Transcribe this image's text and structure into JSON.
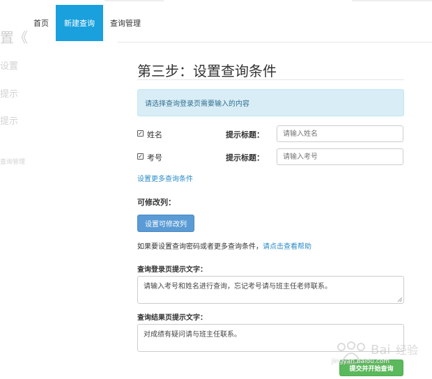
{
  "background_fragments": {
    "title": "置《",
    "line1": "设置",
    "line2": "提示",
    "line3": "提示",
    "line4": "查询管理"
  },
  "nav": {
    "items": [
      {
        "label": "首页",
        "active": false
      },
      {
        "label": "新建查询",
        "active": true
      },
      {
        "label": "查询管理",
        "active": false
      }
    ],
    "active_color": "#1aa0dc"
  },
  "step": {
    "title": "第三步：设置查询条件"
  },
  "info": {
    "text": "请选择查询登录页需要输入的内容"
  },
  "conditions": [
    {
      "name": "姓名",
      "checked": true,
      "prompt_label": "提示标题：",
      "placeholder": "请输入姓名"
    },
    {
      "name": "考号",
      "checked": true,
      "prompt_label": "提示标题：",
      "placeholder": "请输入考号"
    }
  ],
  "more_conditions_link": "设置更多查询条件",
  "editable": {
    "label": "可修改列：",
    "button": "设置可修改列"
  },
  "help": {
    "text": "如果要设置查询密码或者更多查询条件，",
    "link": "请点击查看帮助"
  },
  "login_prompt": {
    "label": "查询登录页提示文字：",
    "value": "请输入考号和姓名进行查询，忘记考号请与班主任老师联系。"
  },
  "result_prompt": {
    "label": "查询结果页提示文字：",
    "value": "对成绩有疑问请与班主任联系。"
  },
  "submit": {
    "label": "提交并开始查询"
  },
  "watermark": {
    "text": "jingyan.baidu.com"
  },
  "colors": {
    "info_bg": "#d9edf7",
    "primary_button": "#5b9bd5",
    "submit_button": "#5cb85c",
    "link": "#2a8bc9"
  }
}
